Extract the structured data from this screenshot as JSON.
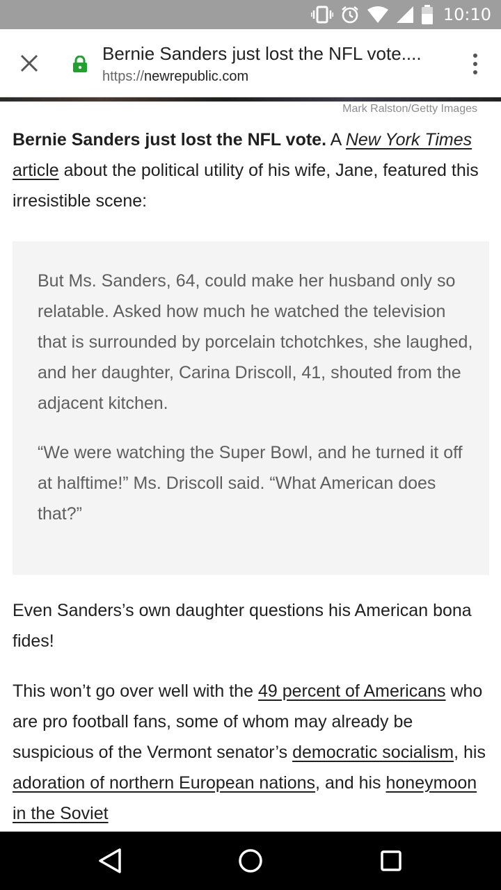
{
  "status_bar": {
    "time": "10:10",
    "icons": [
      "vibrate-icon",
      "alarm-icon",
      "wifi-icon",
      "signal-icon",
      "battery-icon"
    ]
  },
  "toolbar": {
    "title": "Bernie Sanders just lost the NFL vote....",
    "url_scheme": "https://",
    "url_domain": "newrepublic.com",
    "lock_color": "#1fa12d"
  },
  "article": {
    "photo_credit": "Mark Ralston/Getty Images",
    "intro": {
      "bold": "Bernie Sanders just lost the NFL vote.",
      "pre": " A ",
      "link_italic": "New York Times",
      "link_rest": " article",
      "post": " about the political utility of his wife, Jane, featured this irresistible scene:"
    },
    "quote": [
      "But Ms. Sanders, 64, could make her husband only so relatable. Asked how much he watched the television that is surrounded by porcelain tchotchkes, she laughed, and her daughter, Carina Driscoll, 41, shouted from the adjacent kitchen.",
      "“We were watching the Super Bowl, and he turned it off at halftime!” Ms. Driscoll said. “What American does that?”"
    ],
    "para2": "Even Sanders’s own daughter questions his American bona fides!",
    "para3": {
      "t1": "This won’t go over well with the ",
      "link1": "49 percent of Americans",
      "t2": " who are pro football fans, some of whom may already be suspicious of the Vermont senator’s ",
      "link2": "democratic socialism",
      "t3": ", his ",
      "link3": "adoration of northern European nations",
      "t4": ", and his ",
      "link4": "honeymoon in the Soviet"
    }
  },
  "nav": {
    "buttons": [
      "back-icon",
      "home-icon",
      "recents-icon"
    ]
  }
}
